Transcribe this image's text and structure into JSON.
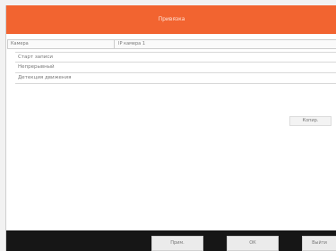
{
  "window": {
    "title": "Привязка"
  },
  "camera": {
    "label": "Камера",
    "value": "IP камера 1"
  },
  "options": [
    {
      "label": "Старт записи"
    },
    {
      "label": "Непрерывный"
    },
    {
      "label": "Детекция движения"
    }
  ],
  "buttons": {
    "copy": "Копир.",
    "apply": "Прим.",
    "ok": "ОК",
    "exit": "Выйти"
  },
  "colors": {
    "accent": "#f26430",
    "bottom_bar": "#161616"
  }
}
